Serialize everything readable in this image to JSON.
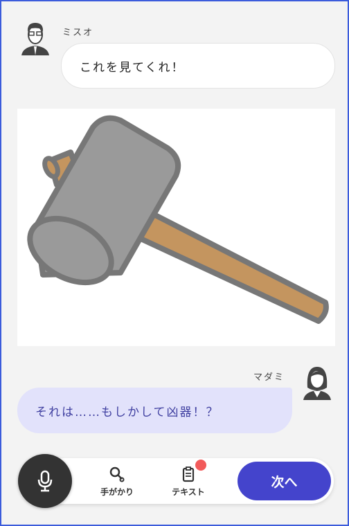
{
  "messages": [
    {
      "speaker": "ミスオ",
      "text": "これを見てくれ！"
    },
    {
      "speaker": "マダミ",
      "text": "それは……もしかして凶器！？"
    }
  ],
  "toolbar": {
    "clue_label": "手がかり",
    "text_label": "テキスト",
    "next_label": "次へ",
    "text_has_notification": true
  },
  "colors": {
    "accent": "#4444cc",
    "notification": "#f25a5a",
    "reply_bubble": "#e2e2fb"
  }
}
